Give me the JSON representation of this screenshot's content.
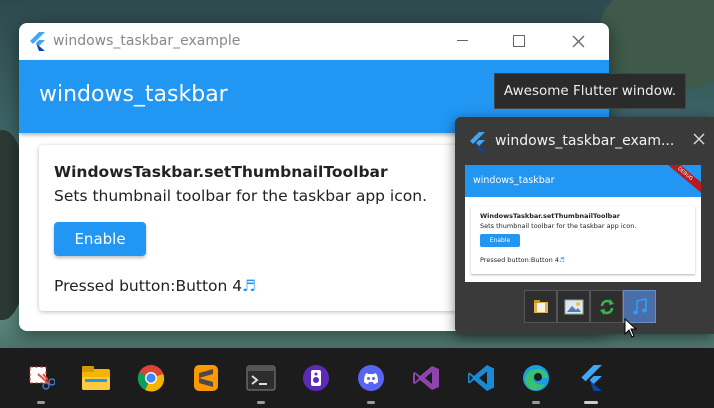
{
  "window": {
    "title": "windows_taskbar_example",
    "appbar_title": "windows_taskbar",
    "card": {
      "heading": "WindowsTaskbar.setThumbnailToolbar",
      "subtitle": "Sets thumbnail toolbar for the taskbar app icon.",
      "button_label": "Enable",
      "pressed_text": "Pressed button:Button 4",
      "note_glyph": "♬"
    }
  },
  "tooltip": "Awesome Flutter window.",
  "thumbnail": {
    "title": "windows_taskbar_exam...",
    "preview": {
      "appbar_title": "windows_taskbar",
      "debug_banner": "DEBUG",
      "heading": "WindowsTaskbar.setThumbnailToolbar",
      "subtitle": "Sets thumbnail toolbar for the taskbar app icon.",
      "button_label": "Enable",
      "pressed_text": "Pressed button:Button 4"
    },
    "toolbar_buttons": [
      "folder-icon",
      "image-icon",
      "refresh-icon",
      "music-note-icon"
    ]
  },
  "taskbar": {
    "apps": [
      "snipping-tool",
      "file-explorer",
      "chrome",
      "sublime-text",
      "terminal",
      "media-app",
      "discord",
      "visual-studio",
      "vs-code",
      "edge",
      "flutter-app"
    ]
  },
  "colors": {
    "accent": "#2196f3",
    "taskbar": "#1c1c1c",
    "thumb_bg": "#3a3a3a"
  }
}
